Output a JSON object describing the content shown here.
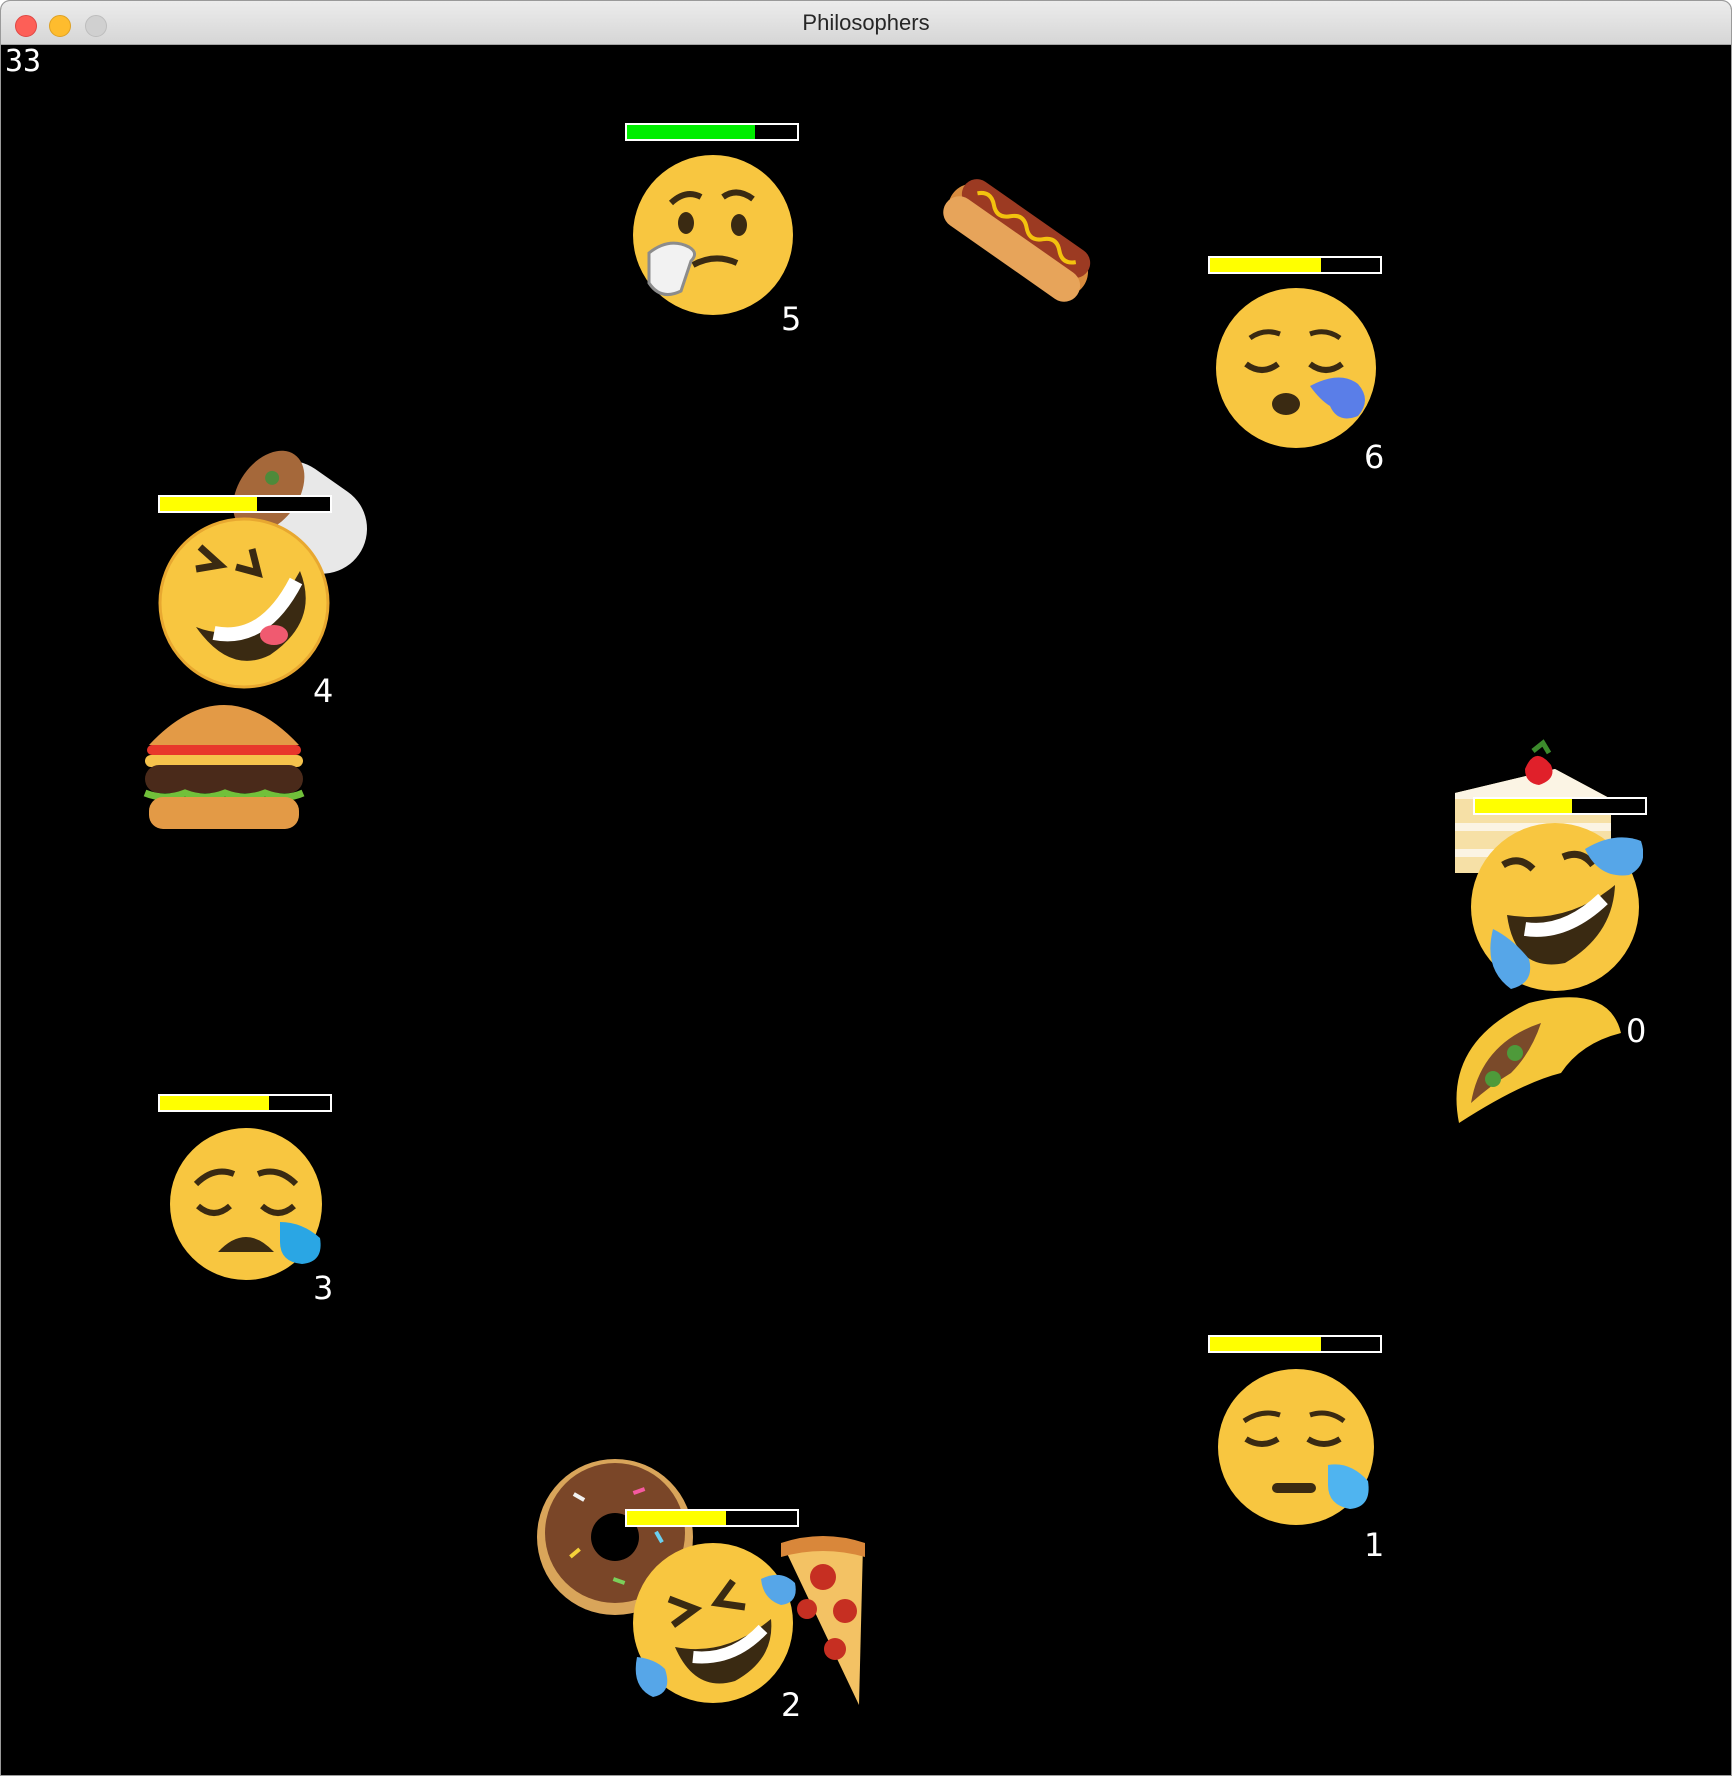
{
  "window": {
    "title": "Philosophers"
  },
  "frame_counter": "33",
  "colors": {
    "eating_bar": "#00ee00",
    "waiting_bar": "#ffff00",
    "face": "#f8c640",
    "tear": "#56a6e8"
  },
  "philosophers": [
    {
      "id": "0",
      "state": "laughing-crying",
      "meter": 0.57,
      "bar_color": "#ffff00",
      "foods": [
        "cake-icon",
        "taco-icon"
      ]
    },
    {
      "id": "1",
      "state": "sad-sweat",
      "meter": 0.65,
      "bar_color": "#ffff00",
      "foods": []
    },
    {
      "id": "2",
      "state": "rolling-laughing",
      "meter": 0.58,
      "bar_color": "#ffff00",
      "foods": [
        "donut-icon",
        "pizza-icon"
      ]
    },
    {
      "id": "3",
      "state": "sad-sweat",
      "meter": 0.64,
      "bar_color": "#ffff00",
      "foods": []
    },
    {
      "id": "4",
      "state": "rolling-laughing",
      "meter": 0.57,
      "bar_color": "#ffff00",
      "foods": [
        "burrito-icon",
        "burger-icon"
      ]
    },
    {
      "id": "5",
      "state": "thinking",
      "meter": 0.75,
      "bar_color": "#00ee00",
      "foods": []
    },
    {
      "id": "6",
      "state": "sleepy",
      "meter": 0.65,
      "bar_color": "#ffff00",
      "foods": []
    }
  ],
  "table_foods": [
    "hotdog-icon"
  ]
}
